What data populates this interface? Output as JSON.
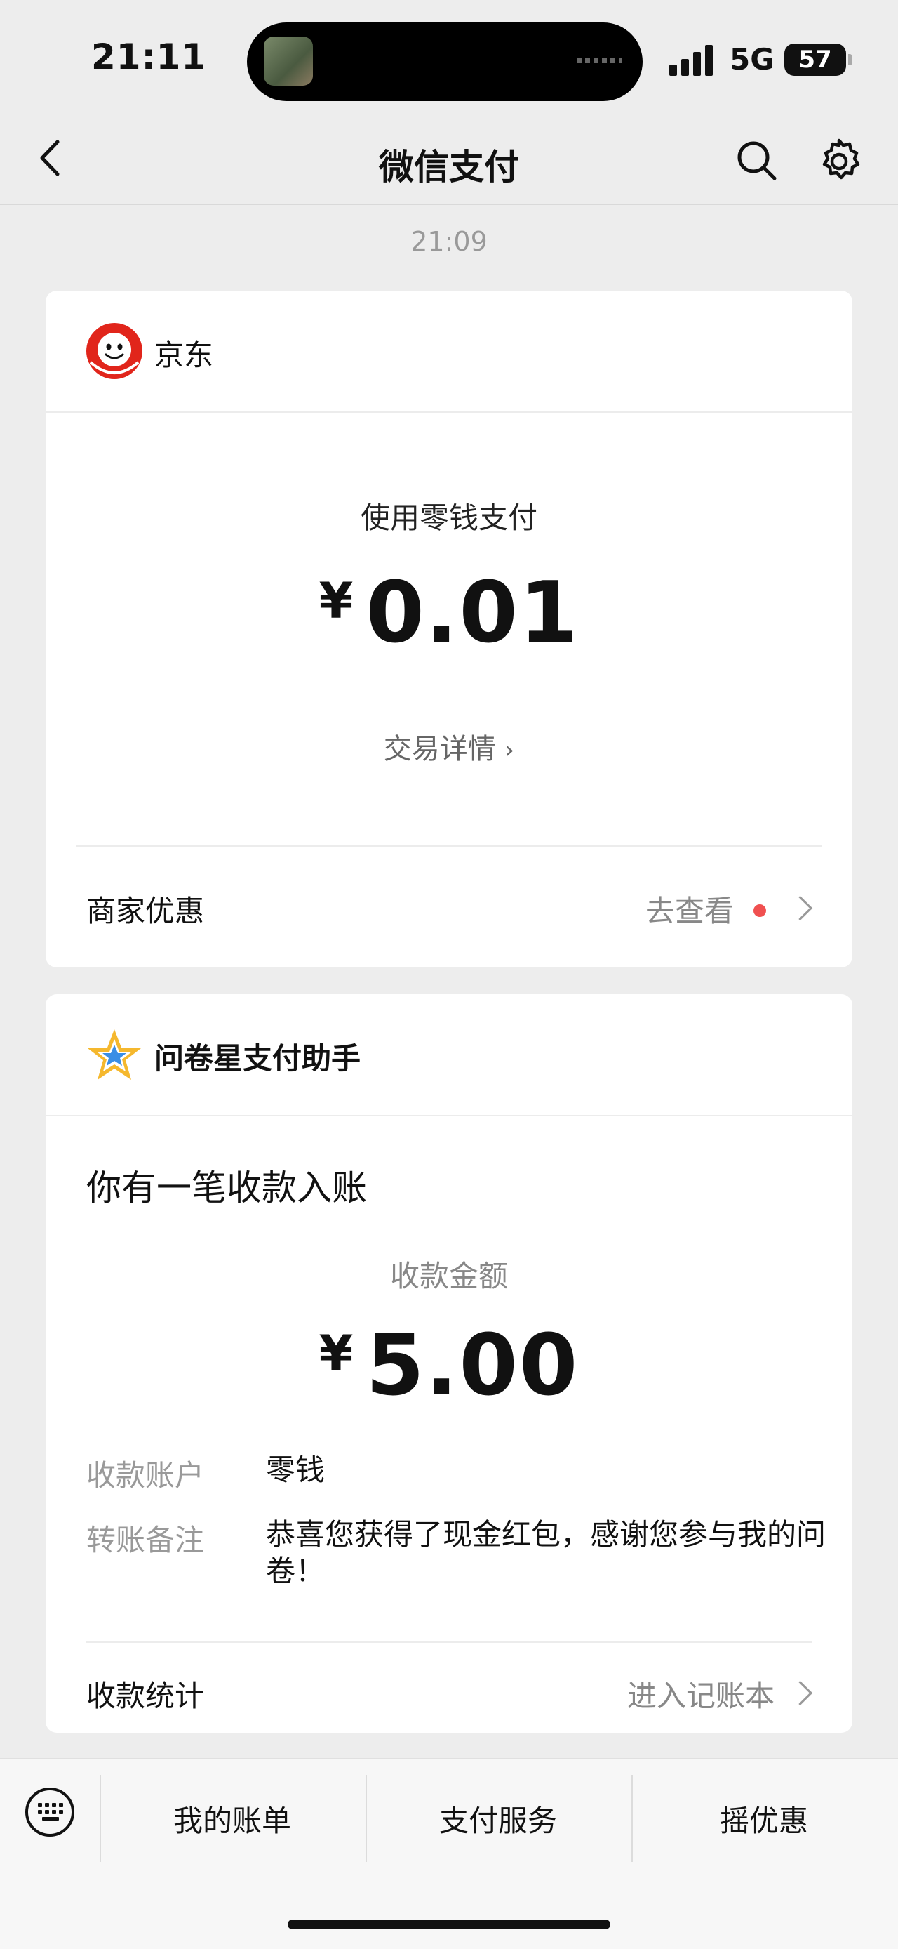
{
  "status_bar": {
    "time": "21:11",
    "network": "5G",
    "battery": "57"
  },
  "nav": {
    "title": "微信支付"
  },
  "chat": {
    "timestamp": "21:09"
  },
  "card_jd": {
    "merchant": "京东",
    "pay_method": "使用零钱支付",
    "currency": "¥",
    "amount": "0.01",
    "detail_link": "交易详情",
    "offer_label": "商家优惠",
    "offer_action": "去查看"
  },
  "card_wjx": {
    "merchant": "问卷星支付助手",
    "notice": "你有一笔收款入账",
    "amount_label": "收款金额",
    "currency": "¥",
    "amount": "5.00",
    "account_key": "收款账户",
    "account_value": "零钱",
    "remark_key": "转账备注",
    "remark_value": "恭喜您获得了现金红包，感谢您参与我的问卷！",
    "stats_label": "收款统计",
    "stats_action": "进入记账本"
  },
  "bottom_menu": {
    "items": [
      "我的账单",
      "支付服务",
      "摇优惠"
    ]
  },
  "colors": {
    "accent_red": "#f05050",
    "jd_red": "#e1251b",
    "star_yellow": "#f5b82e",
    "star_blue": "#3a8ee6"
  },
  "icons": [
    "back-arrow-icon",
    "search-icon",
    "gear-icon",
    "jd-logo-icon",
    "star-icon",
    "keyboard-icon"
  ]
}
